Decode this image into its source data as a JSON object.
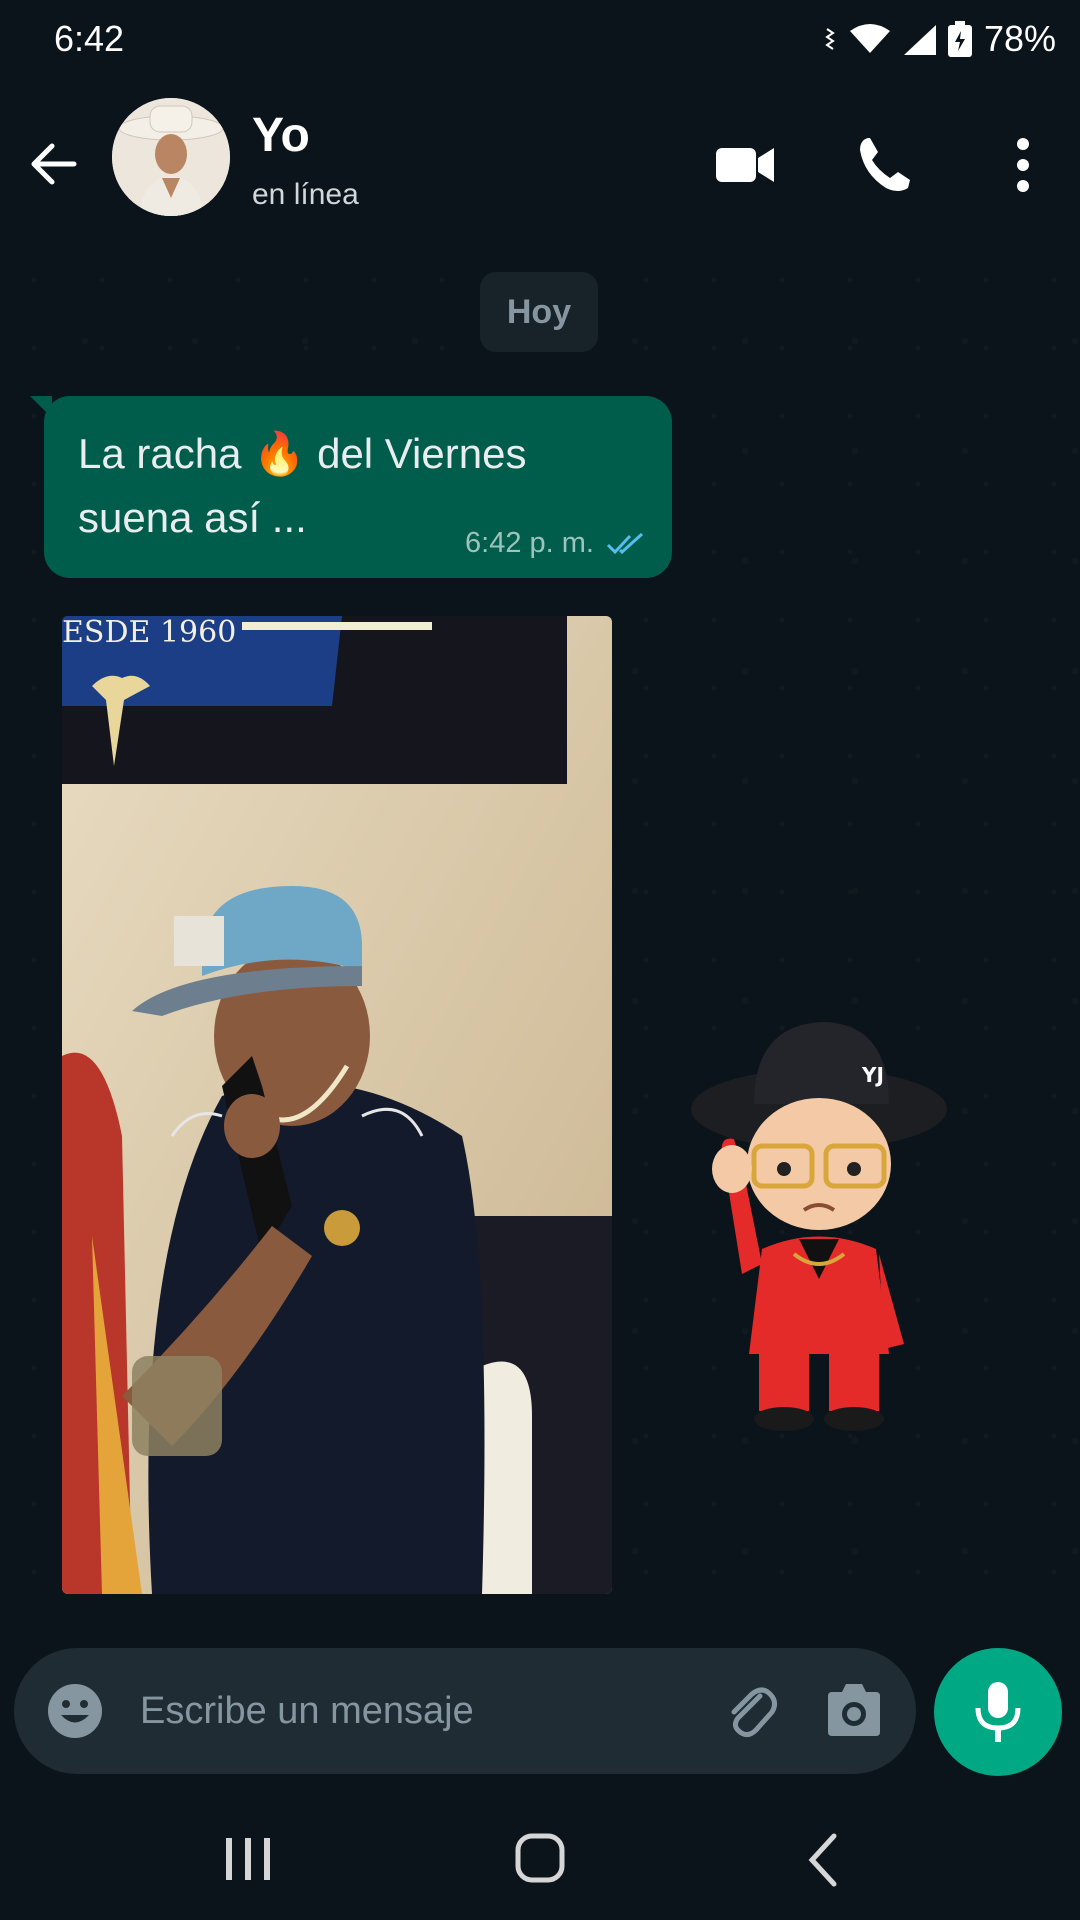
{
  "status_bar": {
    "time": "6:42",
    "battery": "78%"
  },
  "header": {
    "contact_name": "Yo",
    "status": "en línea"
  },
  "chat": {
    "date_chip": "Hoy",
    "messages": [
      {
        "text_line1": "La racha 🔥 del Viernes",
        "text_line2": "suena así ...",
        "time": "6:42 p. m.",
        "read": true
      }
    ],
    "media_caption_visible_text": "ESDE 1960",
    "sticker_text": "YJ"
  },
  "composer": {
    "placeholder": "Escribe un mensaje"
  },
  "colors": {
    "accent": "#00a884",
    "bubble_out": "#005c4b",
    "background": "#0b141a",
    "check_blue": "#53bdeb"
  },
  "icons": [
    "back-arrow-icon",
    "video-call-icon",
    "phone-icon",
    "more-vert-icon",
    "emoji-icon",
    "attach-icon",
    "camera-icon",
    "mic-icon",
    "recents-nav-icon",
    "home-nav-icon",
    "back-nav-icon",
    "wifi-icon",
    "signal-icon",
    "battery-icon",
    "vibrate-icon"
  ]
}
